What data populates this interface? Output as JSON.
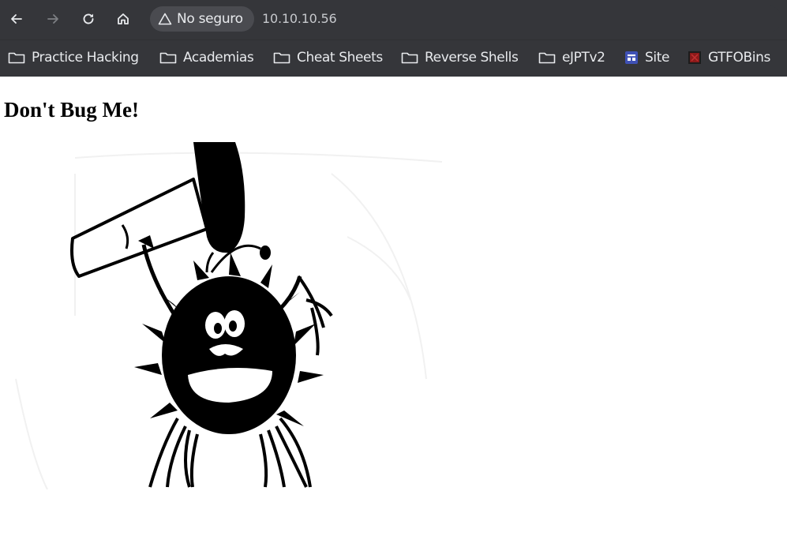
{
  "browser": {
    "security_label": "No seguro",
    "url": "10.10.10.56",
    "nav": {
      "back_icon": "arrow-left-icon",
      "forward_icon": "arrow-right-icon",
      "reload_icon": "reload-icon",
      "home_icon": "home-icon"
    }
  },
  "bookmarks": [
    {
      "label": "Practice Hacking",
      "icon": "folder-icon"
    },
    {
      "label": "Academias",
      "icon": "folder-icon"
    },
    {
      "label": "Cheat Sheets",
      "icon": "folder-icon"
    },
    {
      "label": "Reverse Shells",
      "icon": "folder-icon"
    },
    {
      "label": "eJPTv2",
      "icon": "folder-icon"
    },
    {
      "label": "Site",
      "icon": "site-favicon"
    },
    {
      "label": "GTFOBins",
      "icon": "gtfobins-favicon"
    }
  ],
  "page": {
    "heading": "Don't Bug Me!",
    "image": "cartoon-bug-with-hammer"
  },
  "colors": {
    "toolbar_bg": "#35363a",
    "chip_bg": "#4a4b50",
    "text": "#e8eaed",
    "site_favicon": "#3f51b5",
    "gtfobins_favicon": "#8b1a1a"
  }
}
